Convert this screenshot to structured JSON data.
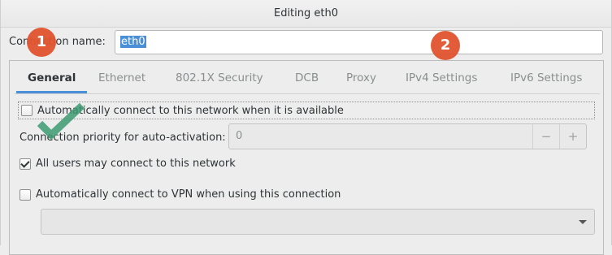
{
  "window": {
    "title": "Editing eth0"
  },
  "connection": {
    "label": "Connection name:",
    "value": "eth0"
  },
  "tabs": [
    {
      "label": "General"
    },
    {
      "label": "Ethernet"
    },
    {
      "label": "802.1X Security"
    },
    {
      "label": "DCB"
    },
    {
      "label": "Proxy"
    },
    {
      "label": "IPv4 Settings"
    },
    {
      "label": "IPv6 Settings"
    }
  ],
  "general": {
    "auto_connect": {
      "label": "Automatically connect to this network when it is available",
      "checked": false
    },
    "priority": {
      "label": "Connection priority for auto-activation:",
      "value": "0",
      "minus": "−",
      "plus": "+"
    },
    "all_users": {
      "label": "All users may connect to this network",
      "checked": true
    },
    "auto_vpn": {
      "label": "Automatically connect to VPN when using this connection",
      "checked": false
    },
    "vpn_select": {
      "value": ""
    }
  },
  "annotations": {
    "badge1": "1",
    "badge2": "2"
  },
  "colors": {
    "accent": "#4a90d9",
    "badge": "#e1542f",
    "check_mark": "#3e9a72"
  }
}
